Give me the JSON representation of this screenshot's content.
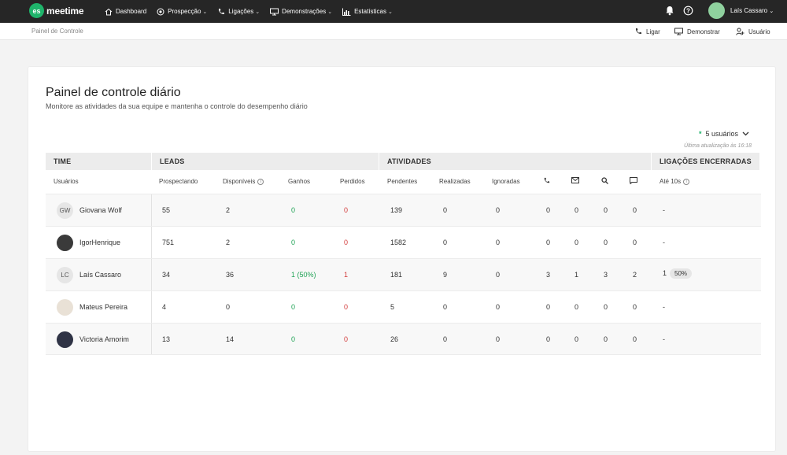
{
  "nav": {
    "logo_badge": "es",
    "logo_text": "meetime",
    "items": [
      {
        "label": "Dashboard",
        "icon": "home-icon",
        "chevron": false
      },
      {
        "label": "Prospecção",
        "icon": "target-icon",
        "chevron": true
      },
      {
        "label": "Ligações",
        "icon": "phone-icon",
        "chevron": true
      },
      {
        "label": "Demonstrações",
        "icon": "monitor-icon",
        "chevron": true
      },
      {
        "label": "Estatísticas",
        "icon": "chart-icon",
        "chevron": true
      }
    ],
    "user_name": "Laís Cassaro"
  },
  "subbar": {
    "breadcrumb": "Painel de Controle",
    "actions": [
      {
        "label": "Ligar",
        "icon": "phone-icon"
      },
      {
        "label": "Demonstrar",
        "icon": "monitor-icon"
      },
      {
        "label": "Usuário",
        "icon": "user-add-icon"
      }
    ]
  },
  "panel": {
    "title": "Painel de controle diário",
    "subtitle": "Monitore as atividades da sua equipe e mantenha o controle do desempenho diário",
    "users_filter": "5 usuários",
    "updated": "Última atualização às 16:18"
  },
  "table": {
    "groups": [
      "TIME",
      "LEADS",
      "ATIVIDADES",
      "LIGAÇÕES ENCERRADAS"
    ],
    "headers": {
      "users": "Usuários",
      "prospecting": "Prospectando",
      "available": "Disponíveis",
      "won": "Ganhos",
      "lost": "Perdidos",
      "pending": "Pendentes",
      "done": "Realizadas",
      "ignored": "Ignoradas",
      "until10": "Até 10s"
    },
    "rows": [
      {
        "initials": "GW",
        "name": "Giovana Wolf",
        "prospecting": "55",
        "available": "2",
        "won": "0",
        "lost": "0",
        "pending": "139",
        "done": "0",
        "ignored": "0",
        "calls": "0",
        "emails": "0",
        "searches": "0",
        "messages": "0",
        "until10": "-",
        "pill": ""
      },
      {
        "initials": "",
        "name": "IgorHenrique",
        "prospecting": "751",
        "available": "2",
        "won": "0",
        "lost": "0",
        "pending": "1582",
        "done": "0",
        "ignored": "0",
        "calls": "0",
        "emails": "0",
        "searches": "0",
        "messages": "0",
        "until10": "-",
        "pill": ""
      },
      {
        "initials": "LC",
        "name": "Laís Cassaro",
        "prospecting": "34",
        "available": "36",
        "won": "1 (50%)",
        "lost": "1",
        "pending": "181",
        "done": "9",
        "ignored": "0",
        "calls": "3",
        "emails": "1",
        "searches": "3",
        "messages": "2",
        "until10": "1",
        "pill": "50%"
      },
      {
        "initials": "",
        "name": "Mateus Pereira",
        "prospecting": "4",
        "available": "0",
        "won": "0",
        "lost": "0",
        "pending": "5",
        "done": "0",
        "ignored": "0",
        "calls": "0",
        "emails": "0",
        "searches": "0",
        "messages": "0",
        "until10": "-",
        "pill": ""
      },
      {
        "initials": "",
        "name": "Victoria Amorim",
        "prospecting": "13",
        "available": "14",
        "won": "0",
        "lost": "0",
        "pending": "26",
        "done": "0",
        "ignored": "0",
        "calls": "0",
        "emails": "0",
        "searches": "0",
        "messages": "0",
        "until10": "-",
        "pill": ""
      }
    ]
  },
  "colors": {
    "topbar": "#262626",
    "brand_green": "#1fb46b",
    "won_green": "#1fa255",
    "lost_red": "#d23a3a"
  }
}
